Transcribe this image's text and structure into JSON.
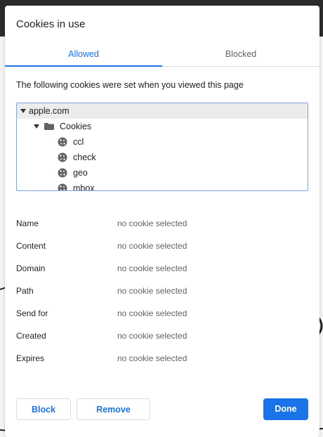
{
  "dialog": {
    "title": "Cookies in use",
    "tabs": [
      {
        "label": "Allowed",
        "selected": true
      },
      {
        "label": "Blocked",
        "selected": false
      }
    ],
    "description": "The following cookies were set when you viewed this page",
    "tree": {
      "site": "apple.com",
      "folder": "Cookies",
      "cookies": [
        "ccl",
        "check",
        "geo",
        "mbox"
      ]
    },
    "details": [
      {
        "key": "Name",
        "value": "no cookie selected"
      },
      {
        "key": "Content",
        "value": "no cookie selected"
      },
      {
        "key": "Domain",
        "value": "no cookie selected"
      },
      {
        "key": "Path",
        "value": "no cookie selected"
      },
      {
        "key": "Send for",
        "value": "no cookie selected"
      },
      {
        "key": "Created",
        "value": "no cookie selected"
      },
      {
        "key": "Expires",
        "value": "no cookie selected"
      }
    ],
    "buttons": {
      "block": "Block",
      "remove": "Remove",
      "done": "Done"
    }
  },
  "colors": {
    "accent": "#1a73e8",
    "tree_border": "#7aa4e9",
    "selected_row": "#ececec",
    "muted_text": "#5f6368"
  }
}
